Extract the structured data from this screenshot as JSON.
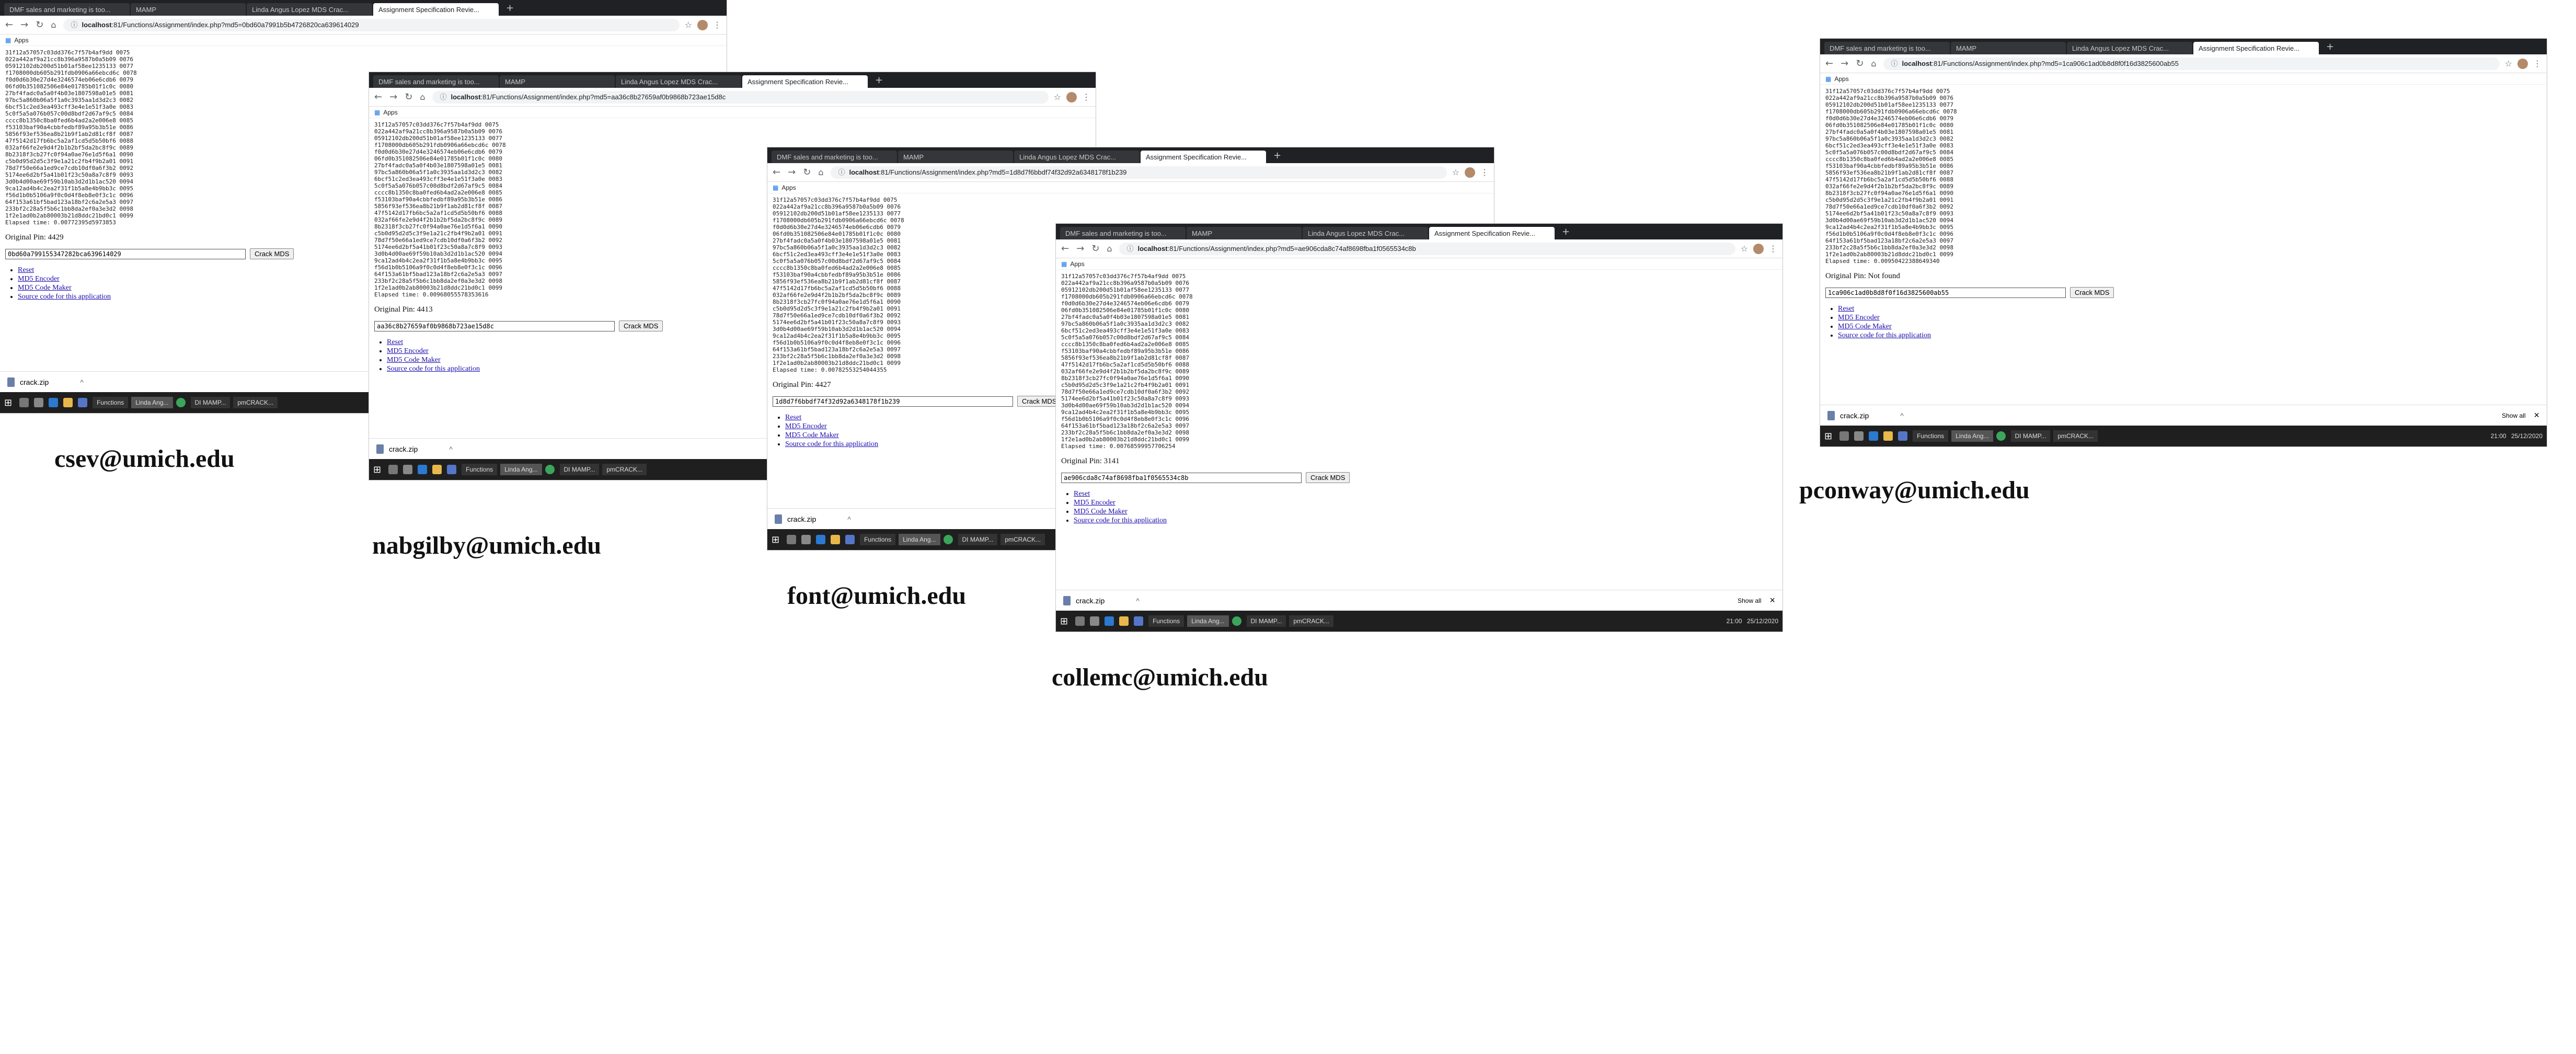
{
  "shared": {
    "tabs": [
      "DMF sales and marketing is too...",
      "MAMP",
      "Linda Angus Lopez MDS Crac...",
      "Assignment Specification Revie..."
    ],
    "new_tab": "+",
    "host": "localhost",
    "bookmarks_label": "Apps",
    "input_placeholder": "Crack MDS",
    "crack_button": "Crack MDS",
    "links": [
      "Reset",
      "MD5 Encoder",
      "MD5 Code Maker",
      "Source code for this application"
    ],
    "download_file": "crack.zip",
    "download_chevron": "^",
    "show_all": "Show all",
    "close_download": "×",
    "taskbar_items": [
      "Functions",
      "Linda Ang...",
      "DI MAMP...",
      "pmCRACK...",
      "MAMP",
      "PHP-05-F..."
    ],
    "tray_time": "21:00",
    "tray_date": "25/12/2020",
    "hash_lines": [
      "31f12a57057c03dd376c7f57b4af9dd 0075",
      "022a442af9a21cc8b396a9587b0a5b09 0076",
      "05912102db200d51b01af58ee1235133 0077",
      "f1708000db605b291fdb0906a66ebcd6c 0078",
      "f0d0d6b30e27d4e3246574eb06e6cdb6 0079",
      "06fd0b351082506e84e01785b01f1c0c 0080",
      "27bf4fadc0a5a0f4b03e1807598a01e5 0081",
      "97bc5a860b06a5f1a0c3935aa1d3d2c3 0082",
      "6bcf51c2ed3ea493cff3e4e1e51f3a0e 0083",
      "5c0f5a5a076b057c00d8bdf2d67af9c5 0084",
      "cccc8b1350c8ba0fed6b4ad2a2e006e8 0085",
      "f53103baf90a4cbbfedbf89a95b3b51e 0086",
      "5856f93ef536ea8b21b9f1ab2d81cf8f 0087",
      "47f5142d17fb6bc5a2af1cd5d5b50bf6 0088",
      "032af66fe2e9d4f2b1b2bf5da2bc8f9c 0089",
      "8b2318f3cb27fc0f94a0ae76e1d5f6a1 0090",
      "c5b0d95d2d5c3f9e1a21c2fb4f9b2a01 0091",
      "78d7f50e66a1ed9ce7cdb10df0a6f3b2 0092",
      "5174ee6d2bf5a41b01f23c50a8a7c8f9 0093",
      "3d0b4d00ae69f59b10ab3d2d1b1ac520 0094",
      "9ca12ad4b4c2ea2f31f1b5a8e4b9bb3c 0095",
      "f56d1b0b5106a9f0c0d4f8eb8e0f3c1c 0096",
      "64f153a61bf5bad123a18bf2c6a2e5a3 0097",
      "233bf2c28a5f5b6c1bb8da2ef0a3e3d2 0098",
      "1f2e1ad0b2ab80003b21d8ddc21bd0c1 0099"
    ],
    "elapsed_label": "Elapsed time:",
    "orig_label": "Original Pin:"
  },
  "screens": [
    {
      "email": "csev@umich.edu",
      "url_path": ":81/Functions/Assignment/index.php?md5=0bd60a7991b5b4726820ca639614029",
      "elapsed": "0.00772395d5973853",
      "orig": "4429",
      "input_value": "0bd60a799155347282bca639614029"
    },
    {
      "email": "nabgilby@umich.edu",
      "url_path": ":81/Functions/Assignment/index.php?md5=aa36c8b27659af0b9868b723ae15d8c",
      "elapsed": "0.00968055578353616",
      "orig": "4413",
      "input_value": "aa36c8b27659af0b9868b723ae15d8c"
    },
    {
      "email": "font@umich.edu",
      "url_path": ":81/Functions/Assignment/index.php?md5=1d8d7f6bbdf74f32d92a6348178f1b239",
      "elapsed": "0.00782553254044355",
      "orig": "4427",
      "input_value": "1d8d7f6bbdf74f32d92a6348178f1b239"
    },
    {
      "email": "collemc@umich.edu",
      "url_path": ":81/Functions/Assignment/index.php?md5=ae906cda8c74af8698fba1f0565534c8b",
      "elapsed": "0.00768599957706254",
      "orig": "3141",
      "input_value": "ae906cda8c74af8698fba1f0565534c8b"
    },
    {
      "email": "pconway@umich.edu",
      "url_path": ":81/Functions/Assignment/index.php?md5=1ca906c1ad0b8d8f0f16d3825600ab55",
      "elapsed": "0.00950422388649340",
      "orig": "Not found",
      "input_value": "1ca906c1ad0b8d8f0f16d3825600ab55"
    }
  ]
}
